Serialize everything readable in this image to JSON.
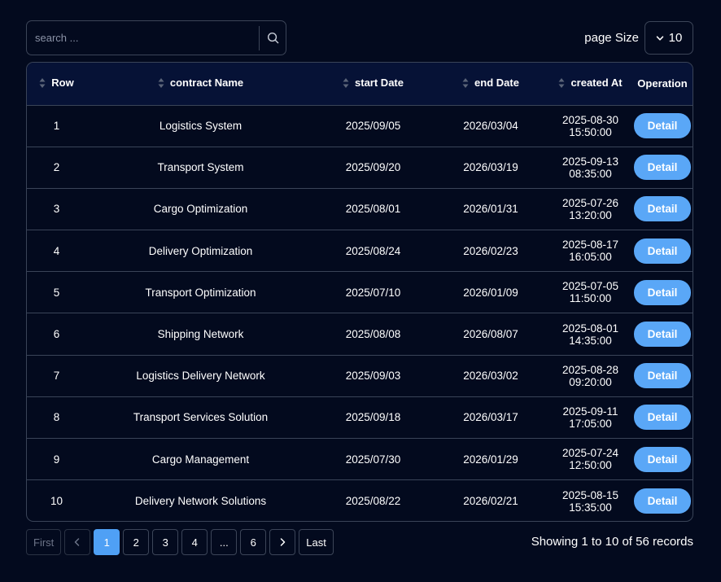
{
  "search": {
    "placeholder": "search ..."
  },
  "page_size": {
    "label": "page Size",
    "value": "10"
  },
  "table": {
    "headers": [
      "Row",
      "contract Name",
      "start Date",
      "end Date",
      "created At",
      "Operation"
    ],
    "action_label": "Detail",
    "rows": [
      {
        "row": "1",
        "name": "Logistics System",
        "start": "2025/09/05",
        "end": "2026/03/04",
        "created": "2025-08-30 15:50:00"
      },
      {
        "row": "2",
        "name": "Transport System",
        "start": "2025/09/20",
        "end": "2026/03/19",
        "created": "2025-09-13 08:35:00"
      },
      {
        "row": "3",
        "name": "Cargo Optimization",
        "start": "2025/08/01",
        "end": "2026/01/31",
        "created": "2025-07-26 13:20:00"
      },
      {
        "row": "4",
        "name": "Delivery Optimization",
        "start": "2025/08/24",
        "end": "2026/02/23",
        "created": "2025-08-17 16:05:00"
      },
      {
        "row": "5",
        "name": "Transport Optimization",
        "start": "2025/07/10",
        "end": "2026/01/09",
        "created": "2025-07-05 11:50:00"
      },
      {
        "row": "6",
        "name": "Shipping Network",
        "start": "2025/08/08",
        "end": "2026/08/07",
        "created": "2025-08-01 14:35:00"
      },
      {
        "row": "7",
        "name": "Logistics Delivery Network",
        "start": "2025/09/03",
        "end": "2026/03/02",
        "created": "2025-08-28 09:20:00"
      },
      {
        "row": "8",
        "name": "Transport Services Solution",
        "start": "2025/09/18",
        "end": "2026/03/17",
        "created": "2025-09-11 17:05:00"
      },
      {
        "row": "9",
        "name": "Cargo Management",
        "start": "2025/07/30",
        "end": "2026/01/29",
        "created": "2025-07-24 12:50:00"
      },
      {
        "row": "10",
        "name": "Delivery Network Solutions",
        "start": "2025/08/22",
        "end": "2026/02/21",
        "created": "2025-08-15 15:35:00"
      }
    ]
  },
  "pagination": {
    "first": "First",
    "last": "Last",
    "pages": [
      "1",
      "2",
      "3",
      "4",
      "...",
      "6"
    ],
    "active_page": "1",
    "summary": "Showing 1 to 10 of 56 records"
  },
  "colors": {
    "background": "#030a1e",
    "header": "#061236",
    "accent": "#5aa7f7",
    "border": "#3a4458"
  },
  "icons": {
    "search": "search-icon",
    "page_size": "chevron-down-icon",
    "sort": "sort-icon",
    "prev": "chevron-left-icon",
    "next": "chevron-right-icon"
  }
}
